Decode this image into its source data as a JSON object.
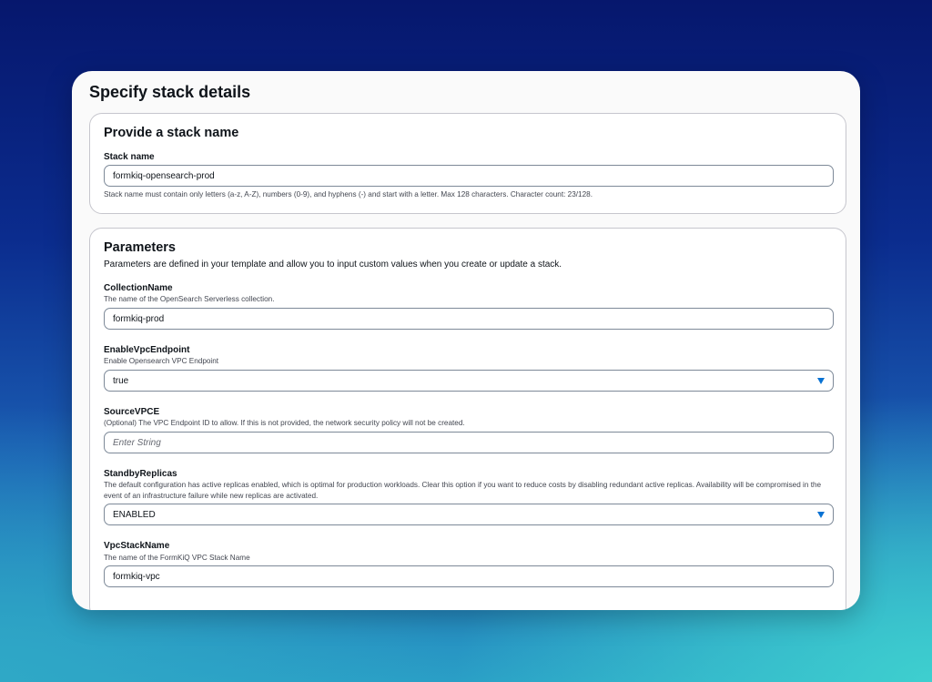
{
  "page": {
    "title": "Specify stack details"
  },
  "stack_section": {
    "title": "Provide a stack name",
    "stack_name_label": "Stack name",
    "stack_name_value": "formkiq-opensearch-prod",
    "constraint_text": "Stack name must contain only letters (a-z, A-Z), numbers (0-9), and hyphens (-) and start with a letter. Max 128 characters. Character count: 23/128."
  },
  "parameters": {
    "title": "Parameters",
    "description": "Parameters are defined in your template and allow you to input custom values when you create or update a stack.",
    "collection_name": {
      "label": "CollectionName",
      "description": "The name of the OpenSearch Serverless collection.",
      "value": "formkiq-prod"
    },
    "enable_vpc_endpoint": {
      "label": "EnableVpcEndpoint",
      "description": "Enable Opensearch VPC Endpoint",
      "selected": "true"
    },
    "source_vpce": {
      "label": "SourceVPCE",
      "description": "(Optional) The VPC Endpoint ID to allow. If this is not provided, the network security policy will not be created.",
      "value": "",
      "placeholder": "Enter String"
    },
    "standby_replicas": {
      "label": "StandbyReplicas",
      "description": "The default configuration has active replicas enabled, which is optimal for production workloads. Clear this option if you want to reduce costs by disabling redundant active replicas. Availability will be compromised in the event of an infrastructure failure while new replicas are activated.",
      "selected": "ENABLED"
    },
    "vpc_stack_name": {
      "label": "VpcStackName",
      "description": "The name of the FormKiQ VPC Stack Name",
      "value": "formkiq-vpc"
    }
  },
  "icons": {
    "dropdown": "caret-down-icon",
    "dropdown_color": "#0972d3"
  }
}
